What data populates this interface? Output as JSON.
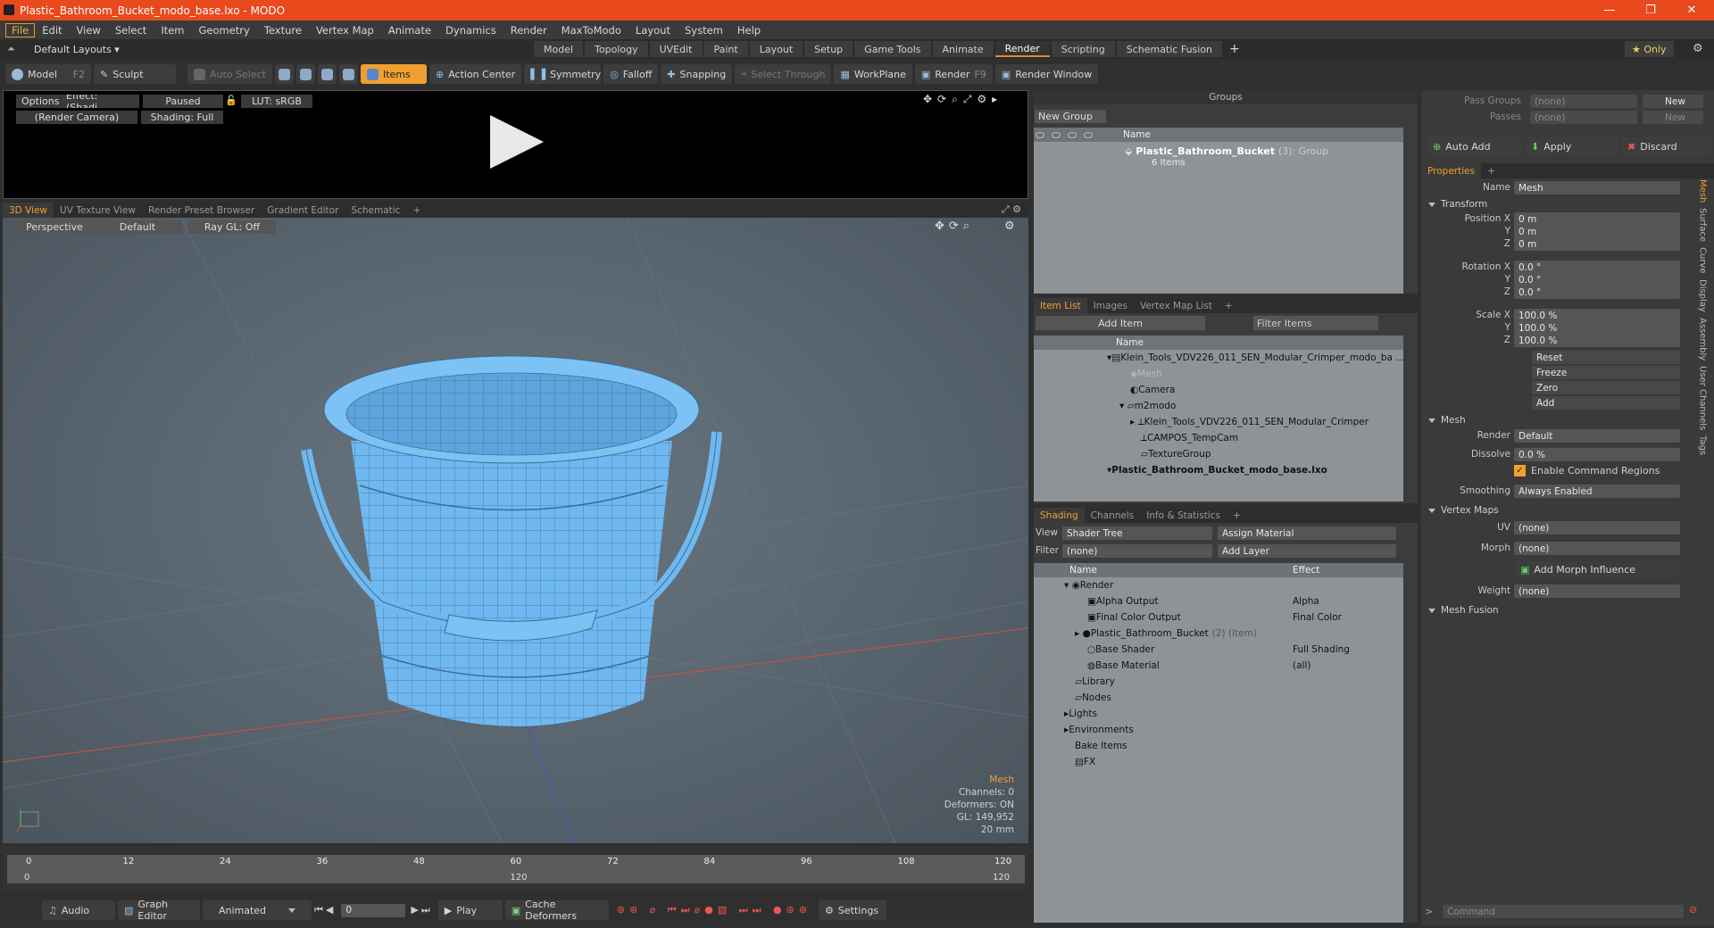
{
  "window": {
    "title": "Plastic_Bathroom_Bucket_modo_base.lxo - MODO",
    "minimize": "—",
    "restore": "❐",
    "close": "✕"
  },
  "menu": [
    "File",
    "Edit",
    "View",
    "Select",
    "Item",
    "Geometry",
    "Texture",
    "Vertex Map",
    "Animate",
    "Dynamics",
    "Render",
    "MaxToModo",
    "Layout",
    "System",
    "Help"
  ],
  "layouts": {
    "label": "Default Layouts ▾",
    "tabs": [
      "Model",
      "Topology",
      "UVEdit",
      "Paint",
      "Layout",
      "Setup",
      "Game Tools",
      "Animate",
      "Render",
      "Scripting",
      "Schematic Fusion"
    ],
    "active": "Render",
    "plus": "+",
    "only": "★ Only"
  },
  "toolbar": {
    "model": "Model",
    "model_key": "F2",
    "sculpt": "Sculpt",
    "auto_select": "Auto Select",
    "items": "Items",
    "action_center": "Action Center",
    "symmetry": "Symmetry",
    "falloff": "Falloff",
    "snapping": "Snapping",
    "select_through": "Select Through",
    "workplane": "WorkPlane",
    "render": "Render",
    "render_key": "F9",
    "render_window": "Render Window"
  },
  "preview": {
    "options": "Options",
    "effect": "Effect: (Shadi...",
    "paused": "Paused",
    "lut": "LUT: sRGB",
    "camera": "(Render Camera)",
    "shading": "Shading: Full"
  },
  "view_tabs": [
    "3D View",
    "UV Texture View",
    "Render Preset Browser",
    "Gradient Editor",
    "Schematic"
  ],
  "viewport": {
    "perspective": "Perspective",
    "default": "Default",
    "raygl": "Ray GL: Off",
    "info_title": "Mesh",
    "info": [
      "Channels: 0",
      "Deformers: ON",
      "GL: 149,952",
      "20 mm"
    ]
  },
  "timeline": {
    "ticks": [
      "0",
      "12",
      "24",
      "36",
      "48",
      "60",
      "72",
      "84",
      "96",
      "108",
      "120"
    ],
    "bottom_ticks": [
      "0",
      "120",
      "120"
    ]
  },
  "bottombar": {
    "audio": "Audio",
    "graph_editor": "Graph Editor",
    "animated": "Animated",
    "frame": "0",
    "play": "Play",
    "cache": "Cache Deformers",
    "settings": "Settings"
  },
  "groups": {
    "title": "Groups",
    "new_group": "New Group",
    "col_name": "Name",
    "item_name": "Plastic_Bathroom_Bucket",
    "item_count": "(3)",
    "item_type": ": Group",
    "item_sub": "6 Items"
  },
  "itemlist": {
    "tabs": [
      "Item List",
      "Images",
      "Vertex Map List"
    ],
    "add_item": "Add Item",
    "filter": "Filter Items",
    "col_name": "Name",
    "rows": [
      "Klein_Tools_VDV226_011_SEN_Modular_Crimper_modo_ba ...",
      "Mesh",
      "Camera",
      "m2modo",
      "Klein_Tools_VDV226_011_SEN_Modular_Crimper",
      "CAMPOS_TempCam",
      "TextureGroup",
      "Plastic_Bathroom_Bucket_modo_base.lxo"
    ]
  },
  "shading": {
    "tabs": [
      "Shading",
      "Channels",
      "Info & Statistics"
    ],
    "view_label": "View",
    "view_value": "Shader Tree",
    "assign": "Assign Material",
    "filter_label": "Filter",
    "filter_value": "(none)",
    "add_layer": "Add Layer",
    "col_name": "Name",
    "col_effect": "Effect",
    "rows": [
      {
        "name": "Render",
        "effect": ""
      },
      {
        "name": "Alpha Output",
        "effect": "Alpha"
      },
      {
        "name": "Final Color Output",
        "effect": "Final Color"
      },
      {
        "name": "Plastic_Bathroom_Bucket",
        "extra": "(2) (Item)",
        "effect": ""
      },
      {
        "name": "Base Shader",
        "effect": "Full Shading"
      },
      {
        "name": "Base Material",
        "effect": "(all)"
      },
      {
        "name": "Library",
        "effect": ""
      },
      {
        "name": "Nodes",
        "effect": ""
      },
      {
        "name": "Lights",
        "effect": ""
      },
      {
        "name": "Environments",
        "effect": ""
      },
      {
        "name": "Bake Items",
        "effect": ""
      },
      {
        "name": "FX",
        "effect": ""
      }
    ]
  },
  "right": {
    "pass_groups": "Pass Groups",
    "passes": "Passes",
    "none": "(none)",
    "new": "New",
    "auto_add": "Auto Add",
    "apply": "Apply",
    "discard": "Discard",
    "properties_tab": "Properties",
    "name_label": "Name",
    "name_value": "Mesh",
    "transform": "Transform",
    "position_label": "Position X",
    "rotation_label": "Rotation X",
    "scale_label": "Scale X",
    "y": "Y",
    "z": "Z",
    "pos": [
      "0 m",
      "0 m",
      "0 m"
    ],
    "rot": [
      "0.0 °",
      "0.0 °",
      "0.0 °"
    ],
    "scale": [
      "100.0 %",
      "100.0 %",
      "100.0 %"
    ],
    "actions": [
      "Reset",
      "Freeze",
      "Zero",
      "Add"
    ],
    "mesh": "Mesh",
    "render_label": "Render",
    "render_value": "Default",
    "dissolve_label": "Dissolve",
    "dissolve_value": "0.0 %",
    "enable_cmd": "Enable Command Regions",
    "smoothing_label": "Smoothing",
    "smoothing_value": "Always Enabled",
    "vertex_maps": "Vertex Maps",
    "uv_label": "UV",
    "uv_value": "(none)",
    "morph_label": "Morph",
    "morph_value": "(none)",
    "add_morph": "Add Morph Influence",
    "weight_label": "Weight",
    "weight_value": "(none)",
    "mesh_fusion": "Mesh Fusion",
    "side_tabs": [
      "Mesh",
      "Surface",
      "Curve",
      "Display",
      "Assembly",
      "User Channels",
      "Tags"
    ],
    "command": "Command"
  },
  "colors": {
    "accent": "#f0a030",
    "title": "#e8491d",
    "mesh": "#6fb8f0"
  }
}
